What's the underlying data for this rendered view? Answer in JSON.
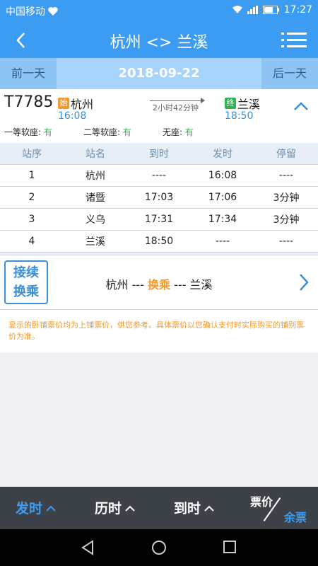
{
  "status_bar": {
    "carrier": "中国移动",
    "time": "17:27"
  },
  "nav": {
    "title": "杭州 <> 兰溪"
  },
  "date_bar": {
    "prev": "前一天",
    "date": "2018-09-22",
    "next": "后一天"
  },
  "train": {
    "number": "T7785",
    "from": {
      "badge": "始",
      "station": "杭州",
      "time": "16:08"
    },
    "duration": "2小时42分钟",
    "to": {
      "badge": "终",
      "station": "兰溪",
      "time": "18:50"
    },
    "seats": [
      {
        "label": "一等软座:",
        "status": "有"
      },
      {
        "label": "二等软座:",
        "status": "有"
      },
      {
        "label": "无座:",
        "status": "有"
      }
    ]
  },
  "stops_table": {
    "headers": [
      "站序",
      "站名",
      "到时",
      "发时",
      "停留"
    ],
    "rows": [
      [
        "1",
        "杭州",
        "----",
        "16:08",
        "----"
      ],
      [
        "2",
        "诸暨",
        "17:03",
        "17:06",
        "3分钟"
      ],
      [
        "3",
        "义乌",
        "17:31",
        "17:34",
        "3分钟"
      ],
      [
        "4",
        "兰溪",
        "18:50",
        "----",
        "----"
      ]
    ]
  },
  "transfer": {
    "button_line1": "接续",
    "button_line2": "换乘",
    "origin": "杭州",
    "sep1": "---",
    "middle": "换乘",
    "sep2": "---",
    "destination": "兰溪"
  },
  "notice": "显示的卧铺票价均为上铺票价，供您参考。具体票价以您确认支付时实际购买的铺别票价为准。",
  "bottom_bar": {
    "depart": "发时",
    "duration": "历时",
    "arrive": "到时",
    "price_top": "票价",
    "price_bottom": "余票"
  },
  "colors": {
    "primary": "#3b9cf1",
    "accent_orange": "#f29a2e",
    "available_green": "#33b155"
  }
}
